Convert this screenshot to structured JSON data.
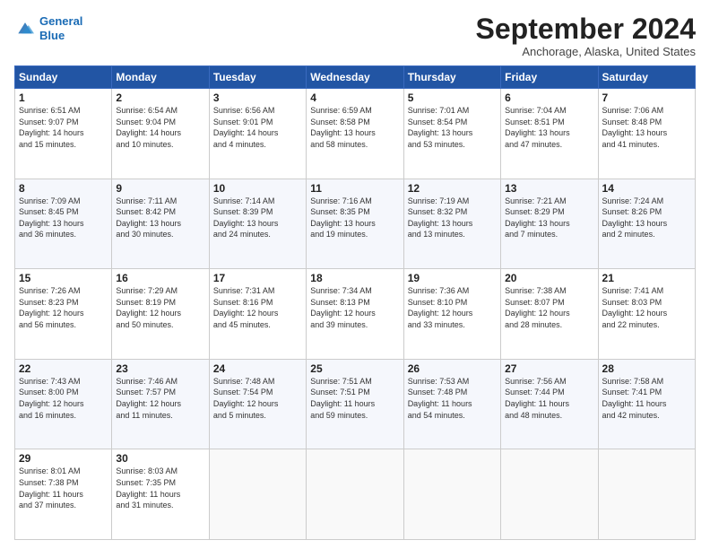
{
  "header": {
    "logo_line1": "General",
    "logo_line2": "Blue",
    "month": "September 2024",
    "location": "Anchorage, Alaska, United States"
  },
  "days_of_week": [
    "Sunday",
    "Monday",
    "Tuesday",
    "Wednesday",
    "Thursday",
    "Friday",
    "Saturday"
  ],
  "weeks": [
    [
      {
        "day": "1",
        "info": "Sunrise: 6:51 AM\nSunset: 9:07 PM\nDaylight: 14 hours\nand 15 minutes."
      },
      {
        "day": "2",
        "info": "Sunrise: 6:54 AM\nSunset: 9:04 PM\nDaylight: 14 hours\nand 10 minutes."
      },
      {
        "day": "3",
        "info": "Sunrise: 6:56 AM\nSunset: 9:01 PM\nDaylight: 14 hours\nand 4 minutes."
      },
      {
        "day": "4",
        "info": "Sunrise: 6:59 AM\nSunset: 8:58 PM\nDaylight: 13 hours\nand 58 minutes."
      },
      {
        "day": "5",
        "info": "Sunrise: 7:01 AM\nSunset: 8:54 PM\nDaylight: 13 hours\nand 53 minutes."
      },
      {
        "day": "6",
        "info": "Sunrise: 7:04 AM\nSunset: 8:51 PM\nDaylight: 13 hours\nand 47 minutes."
      },
      {
        "day": "7",
        "info": "Sunrise: 7:06 AM\nSunset: 8:48 PM\nDaylight: 13 hours\nand 41 minutes."
      }
    ],
    [
      {
        "day": "8",
        "info": "Sunrise: 7:09 AM\nSunset: 8:45 PM\nDaylight: 13 hours\nand 36 minutes."
      },
      {
        "day": "9",
        "info": "Sunrise: 7:11 AM\nSunset: 8:42 PM\nDaylight: 13 hours\nand 30 minutes."
      },
      {
        "day": "10",
        "info": "Sunrise: 7:14 AM\nSunset: 8:39 PM\nDaylight: 13 hours\nand 24 minutes."
      },
      {
        "day": "11",
        "info": "Sunrise: 7:16 AM\nSunset: 8:35 PM\nDaylight: 13 hours\nand 19 minutes."
      },
      {
        "day": "12",
        "info": "Sunrise: 7:19 AM\nSunset: 8:32 PM\nDaylight: 13 hours\nand 13 minutes."
      },
      {
        "day": "13",
        "info": "Sunrise: 7:21 AM\nSunset: 8:29 PM\nDaylight: 13 hours\nand 7 minutes."
      },
      {
        "day": "14",
        "info": "Sunrise: 7:24 AM\nSunset: 8:26 PM\nDaylight: 13 hours\nand 2 minutes."
      }
    ],
    [
      {
        "day": "15",
        "info": "Sunrise: 7:26 AM\nSunset: 8:23 PM\nDaylight: 12 hours\nand 56 minutes."
      },
      {
        "day": "16",
        "info": "Sunrise: 7:29 AM\nSunset: 8:19 PM\nDaylight: 12 hours\nand 50 minutes."
      },
      {
        "day": "17",
        "info": "Sunrise: 7:31 AM\nSunset: 8:16 PM\nDaylight: 12 hours\nand 45 minutes."
      },
      {
        "day": "18",
        "info": "Sunrise: 7:34 AM\nSunset: 8:13 PM\nDaylight: 12 hours\nand 39 minutes."
      },
      {
        "day": "19",
        "info": "Sunrise: 7:36 AM\nSunset: 8:10 PM\nDaylight: 12 hours\nand 33 minutes."
      },
      {
        "day": "20",
        "info": "Sunrise: 7:38 AM\nSunset: 8:07 PM\nDaylight: 12 hours\nand 28 minutes."
      },
      {
        "day": "21",
        "info": "Sunrise: 7:41 AM\nSunset: 8:03 PM\nDaylight: 12 hours\nand 22 minutes."
      }
    ],
    [
      {
        "day": "22",
        "info": "Sunrise: 7:43 AM\nSunset: 8:00 PM\nDaylight: 12 hours\nand 16 minutes."
      },
      {
        "day": "23",
        "info": "Sunrise: 7:46 AM\nSunset: 7:57 PM\nDaylight: 12 hours\nand 11 minutes."
      },
      {
        "day": "24",
        "info": "Sunrise: 7:48 AM\nSunset: 7:54 PM\nDaylight: 12 hours\nand 5 minutes."
      },
      {
        "day": "25",
        "info": "Sunrise: 7:51 AM\nSunset: 7:51 PM\nDaylight: 11 hours\nand 59 minutes."
      },
      {
        "day": "26",
        "info": "Sunrise: 7:53 AM\nSunset: 7:48 PM\nDaylight: 11 hours\nand 54 minutes."
      },
      {
        "day": "27",
        "info": "Sunrise: 7:56 AM\nSunset: 7:44 PM\nDaylight: 11 hours\nand 48 minutes."
      },
      {
        "day": "28",
        "info": "Sunrise: 7:58 AM\nSunset: 7:41 PM\nDaylight: 11 hours\nand 42 minutes."
      }
    ],
    [
      {
        "day": "29",
        "info": "Sunrise: 8:01 AM\nSunset: 7:38 PM\nDaylight: 11 hours\nand 37 minutes."
      },
      {
        "day": "30",
        "info": "Sunrise: 8:03 AM\nSunset: 7:35 PM\nDaylight: 11 hours\nand 31 minutes."
      },
      {
        "day": "",
        "info": ""
      },
      {
        "day": "",
        "info": ""
      },
      {
        "day": "",
        "info": ""
      },
      {
        "day": "",
        "info": ""
      },
      {
        "day": "",
        "info": ""
      }
    ]
  ]
}
